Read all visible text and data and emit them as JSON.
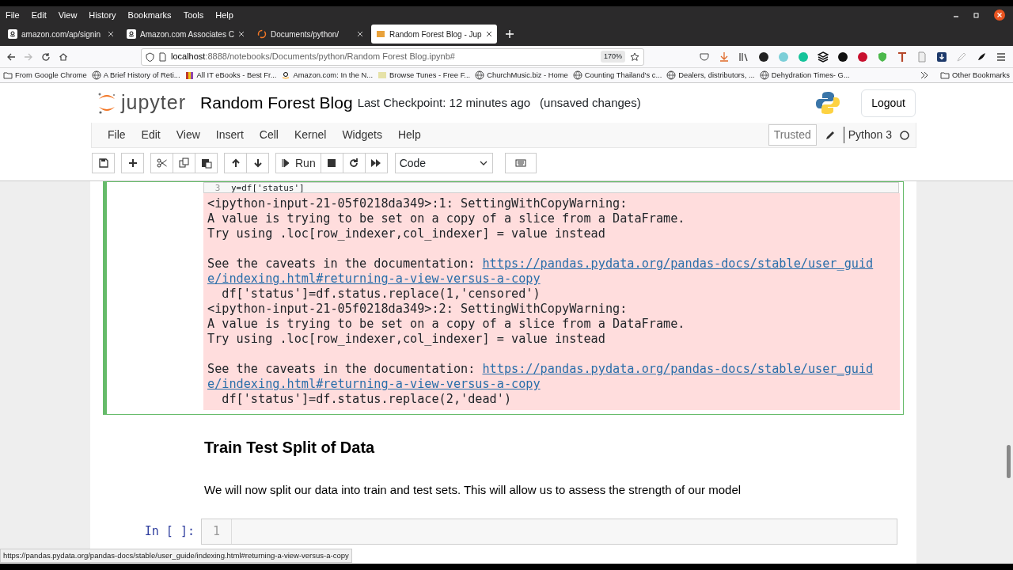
{
  "browser_menu": [
    "File",
    "Edit",
    "View",
    "History",
    "Bookmarks",
    "Tools",
    "Help"
  ],
  "tabs": [
    {
      "label": "amazon.com/ap/signin",
      "selected": false
    },
    {
      "label": "Amazon.com Associates C",
      "selected": false
    },
    {
      "label": "Documents/python/",
      "selected": false
    },
    {
      "label": "Random Forest Blog - Jup",
      "selected": true
    }
  ],
  "address": {
    "host": "localhost",
    "path": ":8888/notebooks/Documents/python/Random Forest Blog.ipynb#",
    "zoom": "170%"
  },
  "bookmarks": [
    "From Google Chrome",
    "A Brief History of Reti...",
    "All IT eBooks - Best Fr...",
    "Amazon.com: In the N...",
    "Browse Tunes - Free F...",
    "ChurchMusic.biz - Home",
    "Counting Thailand's c...",
    "Dealers, distributors, ...",
    "Dehydration Times- G..."
  ],
  "other_bookmarks": "Other Bookmarks",
  "notebook": {
    "logo_text": "jupyter",
    "title": "Random Forest Blog",
    "checkpoint": "Last Checkpoint: 12 minutes ago",
    "unsaved": "(unsaved changes)",
    "logout": "Logout"
  },
  "menu": [
    "File",
    "Edit",
    "View",
    "Insert",
    "Cell",
    "Kernel",
    "Widgets",
    "Help"
  ],
  "trusted": "Trusted",
  "kernel": "Python 3",
  "toolbar": {
    "run": "Run",
    "cell_type": "Code"
  },
  "cells": [
    {
      "kind": "code_output",
      "selected": true,
      "code_line_number": "3",
      "code": "y=df['status']",
      "output": [
        {
          "text": "<ipython-input-21-05f0218da349>:1: SettingWithCopyWarning:"
        },
        {
          "text": "A value is trying to be set on a copy of a slice from a DataFrame."
        },
        {
          "text": "Try using .loc[row_indexer,col_indexer] = value instead"
        },
        {
          "kind": "blank"
        },
        {
          "text": "See the caveats in the documentation: ",
          "link": "https://pandas.pydata.org/pandas-docs/stable/user_guide/indexing.html#returning-a-view-versus-a-copy"
        },
        {
          "text": "  df['status']=df.status.replace(1,'censored')"
        },
        {
          "text": "<ipython-input-21-05f0218da349>:2: SettingWithCopyWarning:"
        },
        {
          "text": "A value is trying to be set on a copy of a slice from a DataFrame."
        },
        {
          "text": "Try using .loc[row_indexer,col_indexer] = value instead"
        },
        {
          "kind": "blank"
        },
        {
          "text": "See the caveats in the documentation: ",
          "link": "https://pandas.pydata.org/pandas-docs/stable/user_guide/indexing.html#returning-a-view-versus-a-copy"
        },
        {
          "text": "  df['status']=df.status.replace(2,'dead')"
        }
      ]
    },
    {
      "kind": "markdown",
      "selected": false,
      "heading": "Train Test Split of Data",
      "paragraph": "We will now split our data into train and test sets. This will allow us to assess the strength of our model"
    },
    {
      "kind": "code",
      "selected": false,
      "prompt": "In [ ]:",
      "code_line_number": "1"
    }
  ],
  "status_url": "https://pandas.pydata.org/pandas-docs/stable/user_guide/indexing.html#returning-a-view-versus-a-copy"
}
